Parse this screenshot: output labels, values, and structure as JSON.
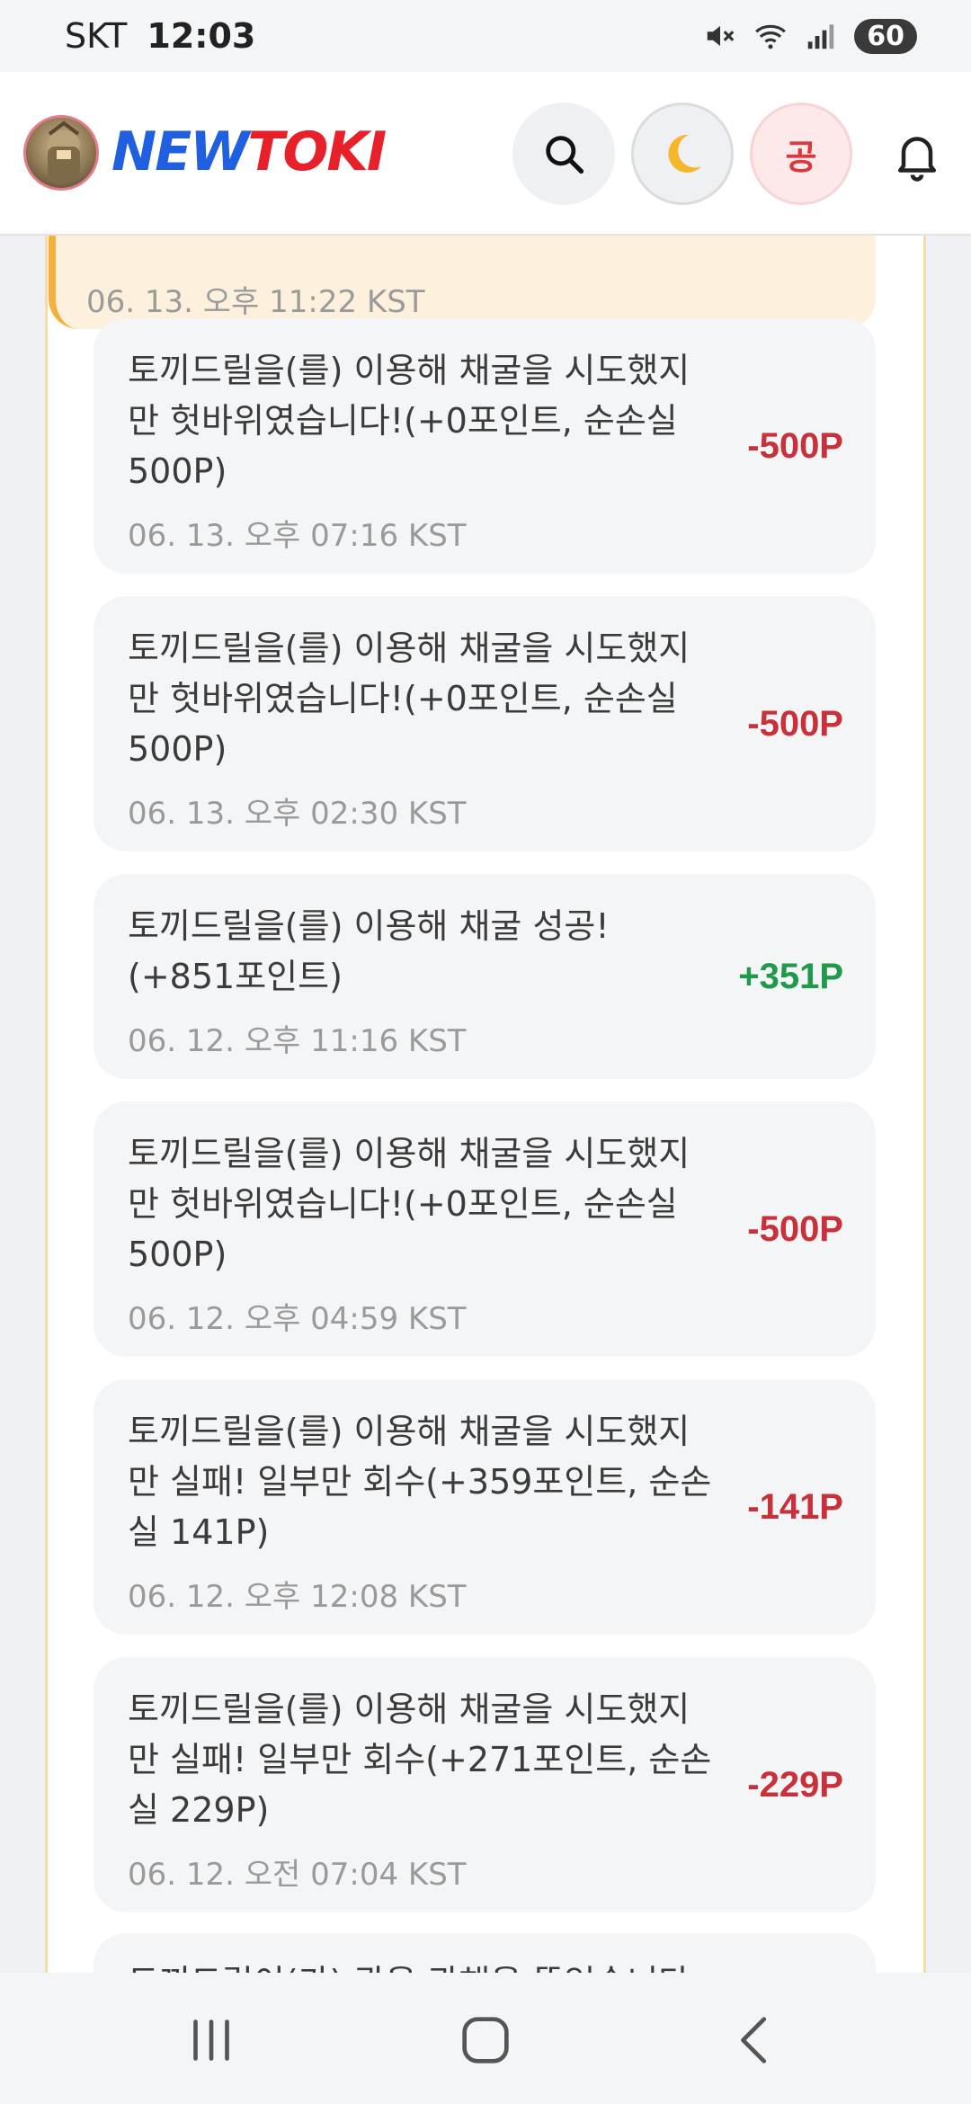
{
  "status_bar": {
    "carrier": "SKT",
    "time": "12:03",
    "battery": "60",
    "icons": [
      "mute-icon",
      "wifi-icon",
      "signal-icon"
    ]
  },
  "header": {
    "logo_part1": "NEW",
    "logo_part2": "TOKI",
    "gong_label": "공",
    "icons": [
      "search-icon",
      "moon-icon",
      "bell-icon"
    ]
  },
  "highlight_item": {
    "date": "06. 13. 오후 11:22 KST"
  },
  "items": [
    {
      "message": "토끼드릴을(를) 이용해 채굴을 시도했지만 헛바위였습니다!(+0포인트, 순손실 500P)",
      "date": "06. 13. 오후 07:16 KST",
      "amount": "-500P",
      "positive": false
    },
    {
      "message": "토끼드릴을(를) 이용해 채굴을 시도했지만 헛바위였습니다!(+0포인트, 순손실 500P)",
      "date": "06. 13. 오후 02:30 KST",
      "amount": "-500P",
      "positive": false
    },
    {
      "message": "토끼드릴을(를) 이용해 채굴 성공!(+851포인트)",
      "date": "06. 12. 오후 11:16 KST",
      "amount": "+351P",
      "positive": true
    },
    {
      "message": "토끼드릴을(를) 이용해 채굴을 시도했지만 헛바위였습니다!(+0포인트, 순손실 500P)",
      "date": "06. 12. 오후 04:59 KST",
      "amount": "-500P",
      "positive": false
    },
    {
      "message": "토끼드릴을(를) 이용해 채굴을 시도했지만 실패! 일부만 회수(+359포인트, 순손실 141P)",
      "date": "06. 12. 오후 12:08 KST",
      "amount": "-141P",
      "positive": false
    },
    {
      "message": "토끼드릴을(를) 이용해 채굴을 시도했지만 실패! 일부만 회수(+271포인트, 순손실 229P)",
      "date": "06. 12. 오전 07:04 KST",
      "amount": "-229P",
      "positive": false
    }
  ],
  "peek_item": {
    "message": "토끼드릴이(가) 광을 관해을 뚫었습니다"
  },
  "colors": {
    "negative": "#c8313a",
    "positive": "#1f9a4a",
    "logo_blue": "#1f5fe0",
    "logo_red": "#e8202a",
    "highlight": "#f5b13d"
  }
}
